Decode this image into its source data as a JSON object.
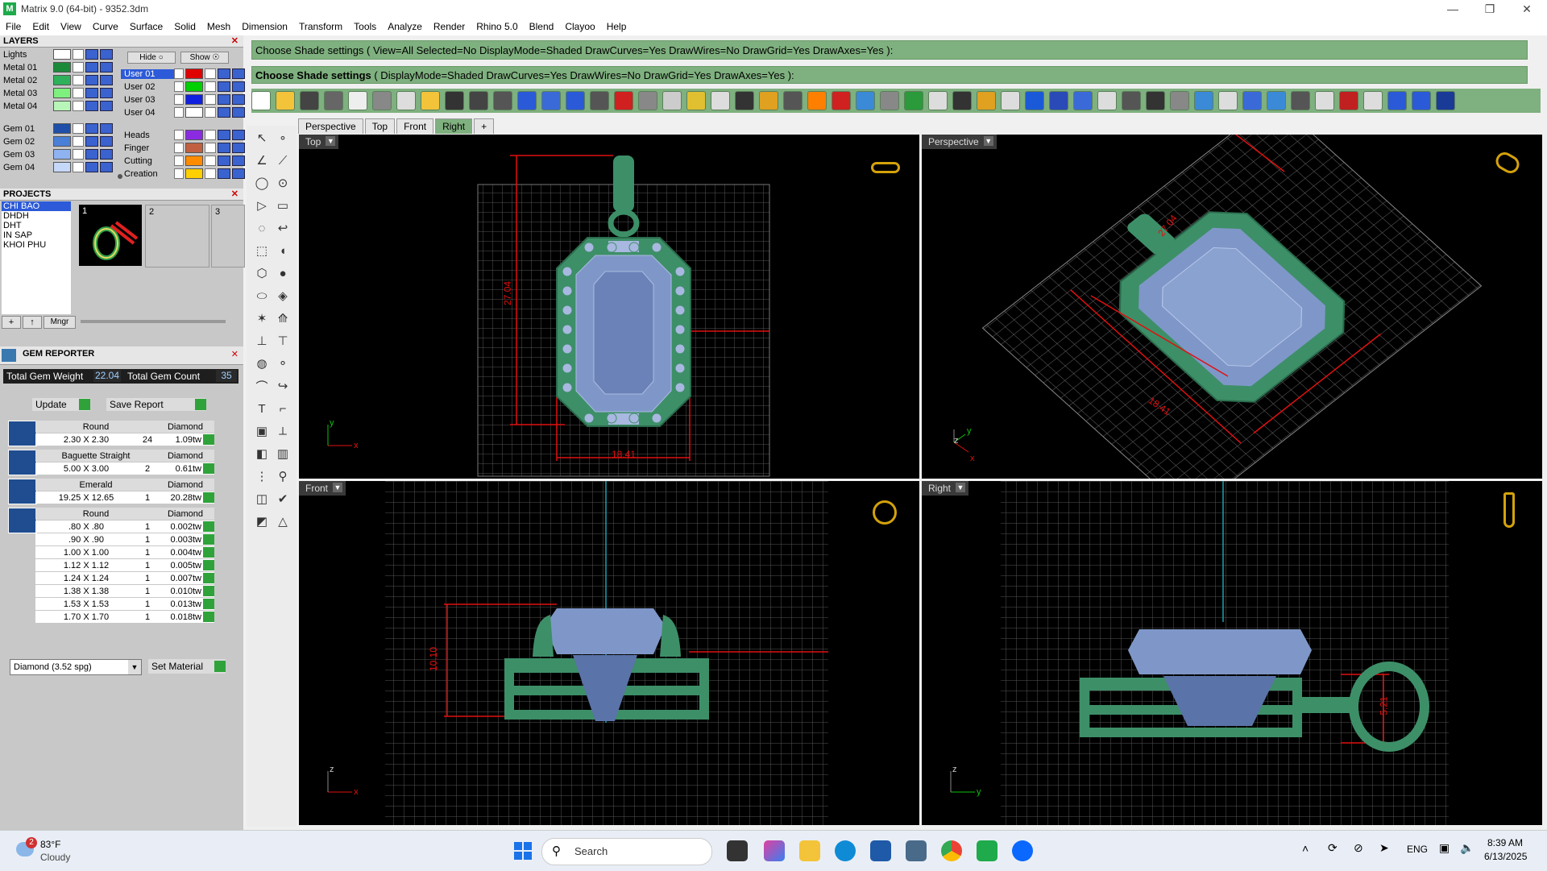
{
  "window": {
    "title": "Matrix 9.0 (64-bit) - 9352.3dm"
  },
  "menu": [
    "File",
    "Edit",
    "View",
    "Curve",
    "Surface",
    "Solid",
    "Mesh",
    "Dimension",
    "Transform",
    "Tools",
    "Analyze",
    "Render",
    "Rhino 5.0",
    "Blend",
    "Clayoo",
    "Help"
  ],
  "layers": {
    "header": "LAYERS",
    "hide_label": "Hide",
    "show_label": "Show",
    "left": [
      {
        "name": "Lights",
        "color": "#ffffff"
      },
      {
        "name": "Metal 01",
        "color": "#1a8a3a"
      },
      {
        "name": "Metal 02",
        "color": "#2fb05a"
      },
      {
        "name": "Metal 03",
        "color": "#7df07d"
      },
      {
        "name": "Metal 04",
        "color": "#b8f5b8"
      },
      {
        "name": "Gem 01",
        "color": "#1f4fa8"
      },
      {
        "name": "Gem 02",
        "color": "#4a7fd8"
      },
      {
        "name": "Gem 03",
        "color": "#8fb3f0"
      },
      {
        "name": "Gem 04",
        "color": "#c6d8f8"
      }
    ],
    "right": [
      {
        "name": "User 01",
        "color": "#e00000"
      },
      {
        "name": "User 02",
        "color": "#00d000"
      },
      {
        "name": "User 03",
        "color": "#1020e0"
      },
      {
        "name": "User 04",
        "color": "#ffffff"
      },
      {
        "name": "Heads",
        "color": "#8a2be2"
      },
      {
        "name": "Finger",
        "color": "#c06040"
      },
      {
        "name": "Cutting",
        "color": "#ff8c00"
      },
      {
        "name": "Creation",
        "color": "#ffd000"
      }
    ]
  },
  "projects": {
    "header": "PROJECTS",
    "items": [
      "CHI BAO",
      "DHDH",
      "DHT",
      "IN SAP",
      "KHOI PHU"
    ],
    "slots": [
      "1",
      "2",
      "3"
    ],
    "mngr_label": "Mngr"
  },
  "gem_reporter": {
    "header": "GEM REPORTER",
    "total_weight_label": "Total Gem Weight",
    "total_weight": "22.04",
    "total_count_label": "Total Gem Count",
    "total_count": "35",
    "update_label": "Update",
    "save_label": "Save Report",
    "groups": [
      {
        "shape": "Round",
        "material": "Diamond",
        "rows": [
          {
            "size": "2.30 X 2.30",
            "qty": "24",
            "tw": "1.09tw"
          }
        ]
      },
      {
        "shape": "Baguette Straight",
        "material": "Diamond",
        "rows": [
          {
            "size": "5.00 X 3.00",
            "qty": "2",
            "tw": "0.61tw"
          }
        ]
      },
      {
        "shape": "Emerald",
        "material": "Diamond",
        "rows": [
          {
            "size": "19.25 X 12.65",
            "qty": "1",
            "tw": "20.28tw"
          }
        ]
      },
      {
        "shape": "Round",
        "material": "Diamond",
        "rows": [
          {
            "size": ".80 X .80",
            "qty": "1",
            "tw": "0.002tw"
          },
          {
            "size": ".90 X .90",
            "qty": "1",
            "tw": "0.003tw"
          },
          {
            "size": "1.00 X 1.00",
            "qty": "1",
            "tw": "0.004tw"
          },
          {
            "size": "1.12 X 1.12",
            "qty": "1",
            "tw": "0.005tw"
          },
          {
            "size": "1.24 X 1.24",
            "qty": "1",
            "tw": "0.007tw"
          },
          {
            "size": "1.38 X 1.38",
            "qty": "1",
            "tw": "0.010tw"
          },
          {
            "size": "1.53 X 1.53",
            "qty": "1",
            "tw": "0.013tw"
          },
          {
            "size": "1.70 X 1.70",
            "qty": "1",
            "tw": "0.018tw"
          }
        ]
      }
    ],
    "material_select": "Diamond    (3.52 spg)",
    "set_material_label": "Set Material"
  },
  "command": {
    "line1": "Choose Shade settings ( View=All  Selected=No  DisplayMode=Shaded  DrawCurves=Yes  DrawWires=No  DrawGrid=Yes  DrawAxes=Yes ):",
    "line2_prefix": "Choose Shade settings",
    "line2_rest": " ( DisplayMode=Shaded  DrawCurves=Yes  DrawWires=No  DrawGrid=Yes  DrawAxes=Yes ):"
  },
  "tabs": [
    "Perspective",
    "Top",
    "Front",
    "Right",
    "+"
  ],
  "viewports": {
    "top": {
      "label": "Top",
      "dim_h": "18.41",
      "dim_v": "27.04"
    },
    "perspective": {
      "label": "Perspective",
      "dim_a": "27.04",
      "dim_b": "18.41"
    },
    "front": {
      "label": "Front",
      "dim_v": "10.10"
    },
    "right": {
      "label": "Right",
      "dim_v": "5.21"
    }
  },
  "axes": {
    "x": "x",
    "y": "y",
    "z": "z"
  },
  "taskbar": {
    "weather_temp": "83°F",
    "weather_desc": "Cloudy",
    "weather_badge": "2",
    "search_placeholder": "Search",
    "lang": "ENG",
    "time": "8:39 AM",
    "date": "6/13/2025"
  },
  "colors": {
    "command_bg": "#7fb07f",
    "metal": "#3d8f68",
    "gem": "#7f97c8",
    "dim": "#e01010",
    "grid": "#5a5a5a"
  }
}
